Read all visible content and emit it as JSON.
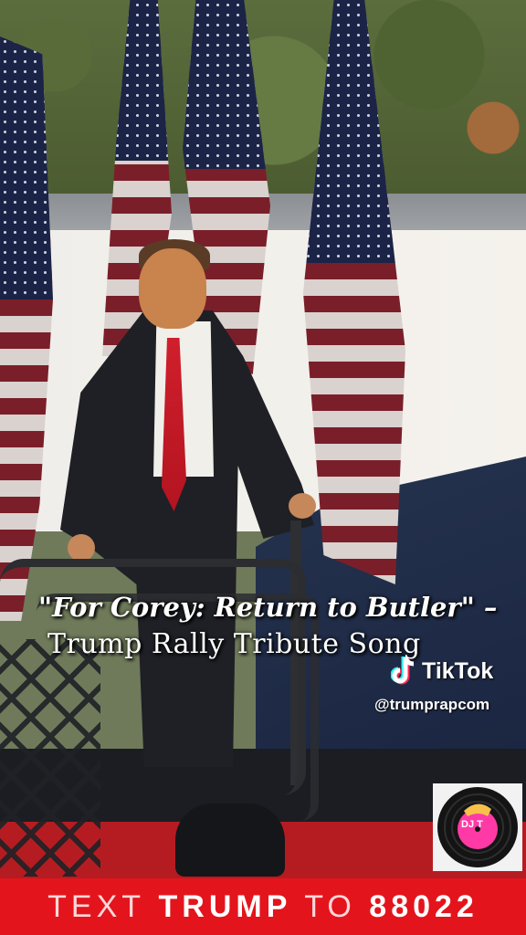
{
  "overlay": {
    "title_line1": "\"For Corey: Return to Butler\" –",
    "title_line2": "Trump Rally Tribute Song"
  },
  "watermark": {
    "platform": "TikTok",
    "handle": "@trumprapcom",
    "icon": "tiktok-note-icon"
  },
  "logo": {
    "text": "DJ T",
    "icon": "vinyl-record-logo"
  },
  "banner": {
    "word1": "TEXT",
    "word2": "TRUMP",
    "word3": "TO",
    "number": "88022",
    "background_color": "#e4141c"
  }
}
